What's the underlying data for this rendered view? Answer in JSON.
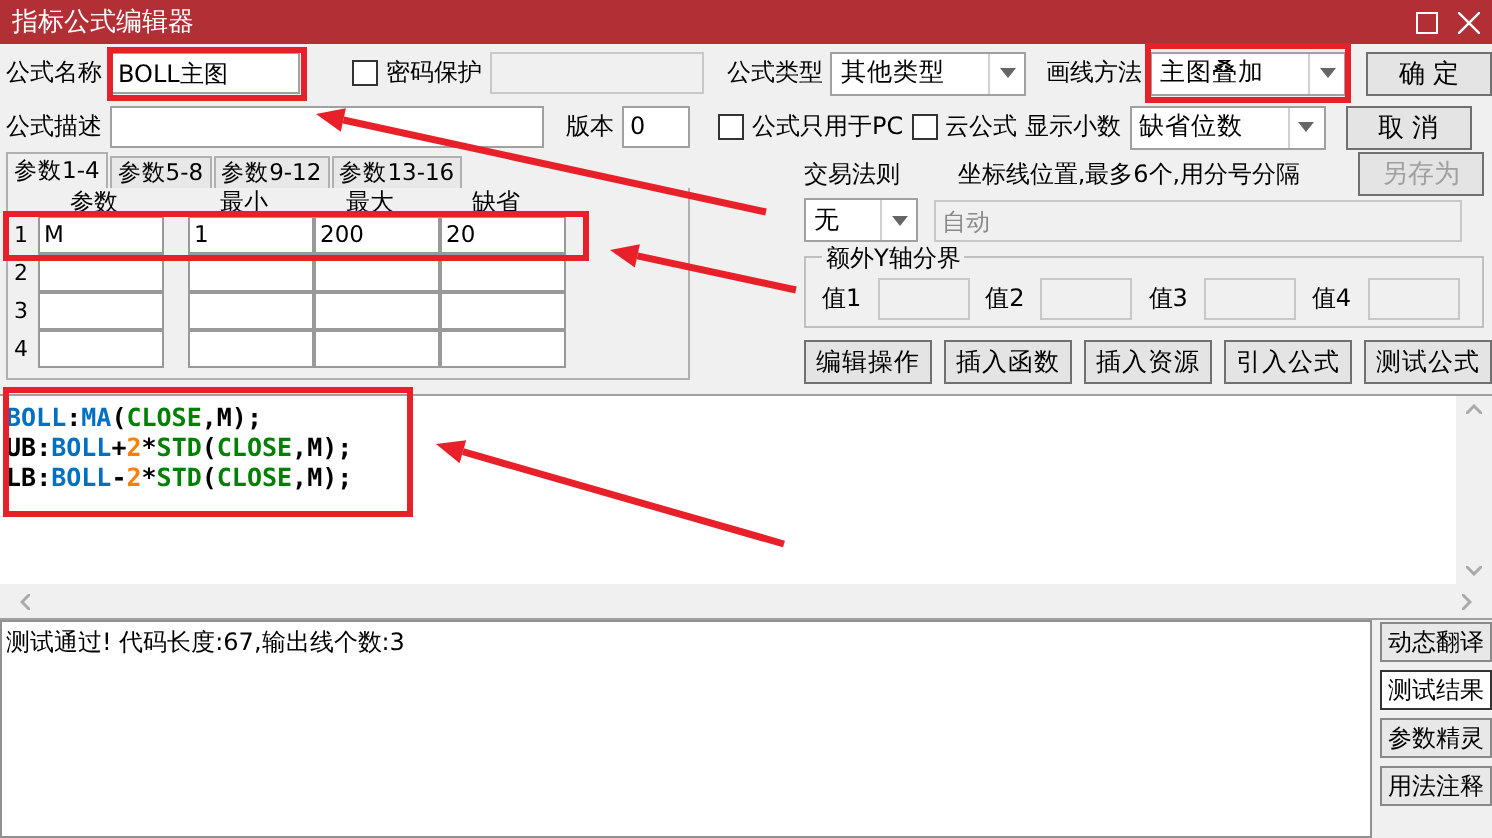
{
  "window": {
    "title": "指标公式编辑器"
  },
  "formula_name": {
    "label": "公式名称",
    "value": "BOLL主图"
  },
  "password": {
    "label": "密码保护",
    "checked": false
  },
  "formula_type": {
    "label": "公式类型",
    "value": "其他类型"
  },
  "draw_method": {
    "label": "画线方法",
    "value": "主图叠加"
  },
  "description": {
    "label": "公式描述"
  },
  "version": {
    "label": "版本",
    "value": "0"
  },
  "pc_only": {
    "label": "公式只用于PC",
    "checked": false
  },
  "cloud": {
    "label": "云公式",
    "checked": false
  },
  "decimals": {
    "label": "显示小数",
    "value": "缺省位数"
  },
  "buttons": [
    {
      "label": "确 定",
      "disabled": false
    },
    {
      "label": "取 消",
      "disabled": false
    },
    {
      "label": "另存为",
      "disabled": true
    }
  ],
  "param_tabs": [
    {
      "label": "参数1-4",
      "selected": true
    },
    {
      "label": "参数5-8",
      "selected": false
    },
    {
      "label": "参数9-12",
      "selected": false
    },
    {
      "label": "参数13-16",
      "selected": false
    }
  ],
  "param_columns": [
    "参数",
    "最小",
    "最大",
    "缺省"
  ],
  "param_rows": [
    {
      "index": "1",
      "values": [
        "M",
        "1",
        "200",
        "20"
      ]
    },
    {
      "index": "2"
    },
    {
      "index": "3"
    },
    {
      "index": "4"
    }
  ],
  "trade_rule": {
    "label": "交易法则",
    "value": "无"
  },
  "axis_lines": {
    "label": "坐标线位置,最多6个,用分号分隔",
    "value": "自动",
    "disabled": true
  },
  "y_axis_group": {
    "title": "额外Y轴分界",
    "fields": [
      "值1",
      "值2",
      "值3",
      "值4"
    ]
  },
  "tool_buttons": [
    "编辑操作",
    "插入函数",
    "插入资源",
    "引入公式",
    "测试公式"
  ],
  "code_lines": [
    {
      "tokens": [
        {
          "text": "BOLL",
          "kind": "ident"
        },
        {
          "text": ":",
          "kind": "punct"
        },
        {
          "text": "MA",
          "kind": "ident"
        },
        {
          "text": "(",
          "kind": "punct"
        },
        {
          "text": "CLOSE",
          "kind": "builtin"
        },
        {
          "text": ",M);",
          "kind": "punct"
        }
      ]
    },
    {
      "tokens": [
        {
          "text": "UB",
          "kind": "punct"
        },
        {
          "text": ":",
          "kind": "punct"
        },
        {
          "text": "BOLL",
          "kind": "ident"
        },
        {
          "text": "+",
          "kind": "punct"
        },
        {
          "text": "2",
          "kind": "number"
        },
        {
          "text": "*",
          "kind": "punct"
        },
        {
          "text": "STD",
          "kind": "builtin"
        },
        {
          "text": "(",
          "kind": "punct"
        },
        {
          "text": "CLOSE",
          "kind": "builtin"
        },
        {
          "text": ",M);",
          "kind": "punct"
        }
      ]
    },
    {
      "tokens": [
        {
          "text": "LB",
          "kind": "punct"
        },
        {
          "text": ":",
          "kind": "punct"
        },
        {
          "text": "BOLL",
          "kind": "ident"
        },
        {
          "text": "-",
          "kind": "punct"
        },
        {
          "text": "2",
          "kind": "number"
        },
        {
          "text": "*",
          "kind": "punct"
        },
        {
          "text": "STD",
          "kind": "builtin"
        },
        {
          "text": "(",
          "kind": "punct"
        },
        {
          "text": "CLOSE",
          "kind": "builtin"
        },
        {
          "text": ",M);",
          "kind": "punct"
        }
      ]
    }
  ],
  "output": {
    "text": "测试通过! 代码长度:67,输出线个数:3"
  },
  "side_buttons": [
    {
      "label": "动态翻译",
      "selected": false
    },
    {
      "label": "测试结果",
      "selected": true
    },
    {
      "label": "参数精灵",
      "selected": false
    },
    {
      "label": "用法注释",
      "selected": false
    }
  ]
}
